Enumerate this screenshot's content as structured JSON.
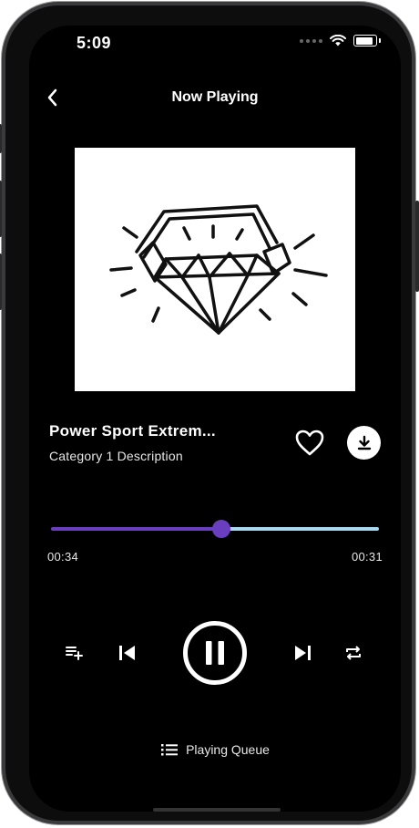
{
  "status_bar": {
    "time": "5:09"
  },
  "header": {
    "title": "Now Playing"
  },
  "track": {
    "title": "Power Sport Extrem...",
    "subtitle": "Category 1 Description",
    "elapsed": "00:34",
    "remaining": "00:31",
    "progress": 0.52
  },
  "queue": {
    "label": "Playing Queue"
  },
  "colors": {
    "accent": "#6a3fbf",
    "track_rest": "#a8d8f0",
    "background": "#000000"
  },
  "icons": {
    "back": "chevron-left-icon",
    "favorite": "heart-outline-icon",
    "download": "download-icon",
    "add_to_queue": "playlist-add-icon",
    "previous": "skip-previous-icon",
    "play_pause": "pause-icon",
    "next": "skip-next-icon",
    "repeat": "repeat-icon",
    "queue": "list-icon"
  }
}
